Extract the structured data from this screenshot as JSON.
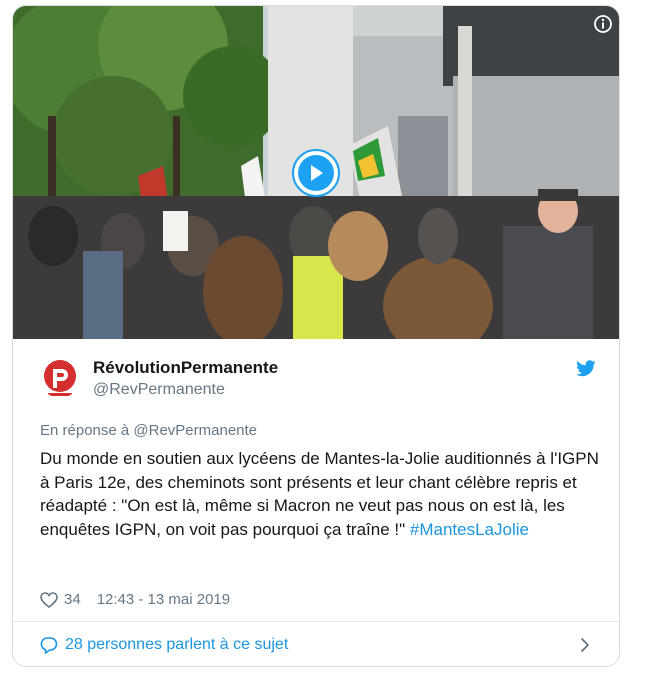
{
  "media": {
    "icons": {
      "play": "play-icon",
      "info": "info-icon"
    }
  },
  "author": {
    "name": "RévolutionPermanente",
    "handle": "@RevPermanente",
    "avatar_color": "#d32f2f"
  },
  "tweet": {
    "reply_to": "En réponse à @RevPermanente",
    "text": "Du monde en soutien aux lycéens de Mantes-la-Jolie auditionnés à l'IGPN à Paris 12e, des cheminots sont présents et leur chant célèbre repris et réadapté : \"On est là, même si Macron ne veut pas nous on est là, les enquêtes IGPN, on voit pas pourquoi ça traîne !\" ",
    "hashtag": "#MantesLaJolie",
    "likes": "34",
    "timestamp": "12:43 - 13 mai 2019"
  },
  "footer": {
    "conversation": "28 personnes parlent à ce sujet"
  },
  "colors": {
    "accent": "#1da1f2",
    "link": "#1b95e0",
    "text": "#14171a",
    "muted": "#657786"
  }
}
